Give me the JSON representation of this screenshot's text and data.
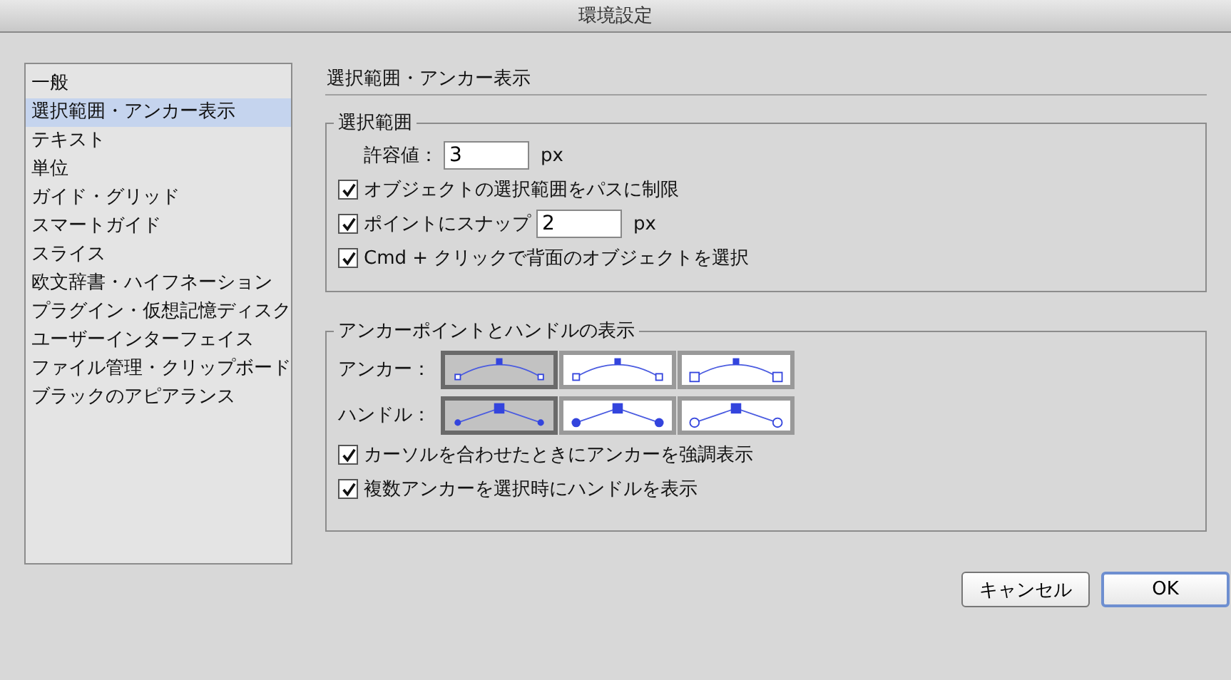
{
  "window": {
    "title": "環境設定"
  },
  "sidebar": {
    "items": [
      {
        "label": "一般",
        "selected": false
      },
      {
        "label": "選択範囲・アンカー表示",
        "selected": true
      },
      {
        "label": "テキスト",
        "selected": false
      },
      {
        "label": "単位",
        "selected": false
      },
      {
        "label": "ガイド・グリッド",
        "selected": false
      },
      {
        "label": "スマートガイド",
        "selected": false
      },
      {
        "label": "スライス",
        "selected": false
      },
      {
        "label": "欧文辞書・ハイフネーション",
        "selected": false
      },
      {
        "label": "プラグイン・仮想記憶ディスク",
        "selected": false
      },
      {
        "label": "ユーザーインターフェイス",
        "selected": false
      },
      {
        "label": "ファイル管理・クリップボード",
        "selected": false
      },
      {
        "label": "ブラックのアピアランス",
        "selected": false
      }
    ]
  },
  "heading": "選択範囲・アンカー表示",
  "selection_group": {
    "title": "選択範囲",
    "tolerance_label": "許容値：",
    "tolerance_value": "3",
    "tolerance_unit": "px",
    "options": [
      {
        "label": "オブジェクトの選択範囲をパスに制限",
        "checked": true
      },
      {
        "label": "ポイントにスナップ",
        "checked": true,
        "value": "2",
        "unit": "px"
      },
      {
        "label": "Cmd + クリックで背面のオブジェクトを選択",
        "checked": true
      }
    ]
  },
  "anchor_group": {
    "title": "アンカーポイントとハンドルの表示",
    "anchor_label": "アンカー：",
    "anchor_styles": [
      {
        "kind": "small",
        "selected": true
      },
      {
        "kind": "medium",
        "selected": false
      },
      {
        "kind": "large",
        "selected": false
      }
    ],
    "handle_label": "ハンドル：",
    "handle_styles": [
      {
        "kind": "dot-small",
        "selected": true
      },
      {
        "kind": "dot-large",
        "selected": false
      },
      {
        "kind": "circle",
        "selected": false
      }
    ],
    "options": [
      {
        "label": "カーソルを合わせたときにアンカーを強調表示",
        "checked": true
      },
      {
        "label": "複数アンカーを選択時にハンドルを表示",
        "checked": true
      }
    ]
  },
  "buttons": [
    {
      "label": "キャンセル",
      "default": false
    },
    {
      "label": "OK",
      "default": true
    }
  ]
}
